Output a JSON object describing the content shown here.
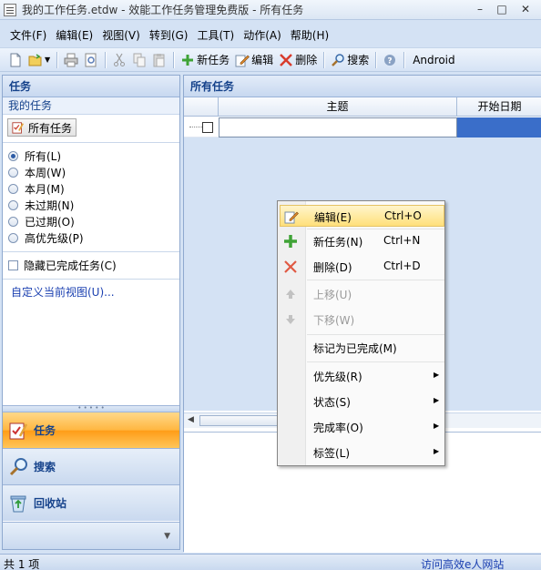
{
  "window": {
    "title": "我的工作任务.etdw - 效能工作任务管理免费版 - 所有任务",
    "minimize": "–",
    "maximize": "□",
    "close": "✕"
  },
  "menubar": [
    "文件(F)",
    "编辑(E)",
    "视图(V)",
    "转到(G)",
    "工具(T)",
    "动作(A)",
    "帮助(H)"
  ],
  "toolbar": {
    "new_task": "新任务",
    "edit": "编辑",
    "delete": "删除",
    "search": "搜索",
    "android": "Android"
  },
  "left_panel": {
    "header": "任务",
    "section_title": "我的任务",
    "all_tasks_button": "所有任务",
    "filters": [
      "所有(L)",
      "本周(W)",
      "本月(M)",
      "未过期(N)",
      "已过期(O)",
      "高优先级(P)"
    ],
    "selected_filter": "所有(L)",
    "hide_completed": "隐藏已完成任务(C)",
    "customize_view": "自定义当前视图(U)...",
    "nav": {
      "tasks": "任务",
      "search": "搜索",
      "recycle": "回收站"
    }
  },
  "main": {
    "header": "所有任务",
    "columns": [
      "主题",
      "开始日期"
    ]
  },
  "context_menu": {
    "items": [
      {
        "label": "编辑(E)",
        "shortcut": "Ctrl+O"
      },
      {
        "label": "新任务(N)",
        "shortcut": "Ctrl+N"
      },
      {
        "label": "删除(D)",
        "shortcut": "Ctrl+D"
      },
      {
        "label": "上移(U)"
      },
      {
        "label": "下移(W)"
      },
      {
        "label": "标记为已完成(M)"
      },
      {
        "label": "优先级(R)"
      },
      {
        "label": "状态(S)"
      },
      {
        "label": "完成率(O)"
      },
      {
        "label": "标签(L)"
      }
    ]
  },
  "statusbar": {
    "count": "共 1 项",
    "link": "访问高效e人网站"
  }
}
